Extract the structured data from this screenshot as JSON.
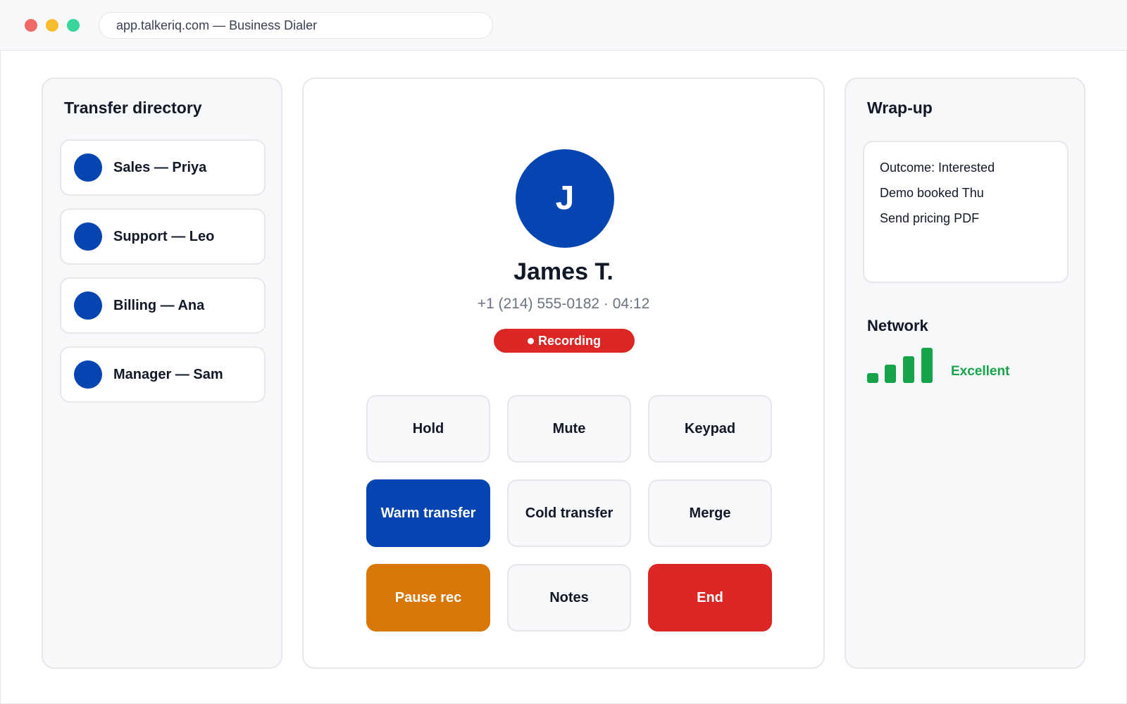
{
  "browser": {
    "url_text": "app.talkeriq.com — Business Dialer"
  },
  "directory": {
    "title": "Transfer directory",
    "items": [
      {
        "label": "Sales — Priya"
      },
      {
        "label": "Support — Leo"
      },
      {
        "label": "Billing — Ana"
      },
      {
        "label": "Manager — Sam"
      }
    ]
  },
  "caller": {
    "initial": "J",
    "name": "James T.",
    "meta": "+1 (214) 555-0182 · 04:12",
    "recording_label": "Recording"
  },
  "controls": {
    "hold": "Hold",
    "mute": "Mute",
    "keypad": "Keypad",
    "warm_transfer": "Warm transfer",
    "cold_transfer": "Cold transfer",
    "merge": "Merge",
    "pause_rec": "Pause rec",
    "notes": "Notes",
    "end": "End"
  },
  "wrapup": {
    "title": "Wrap-up",
    "notes": [
      "Outcome: Interested",
      "Demo booked Thu",
      "Send pricing PDF"
    ]
  },
  "network": {
    "title": "Network",
    "status": "Excellent",
    "signal_bars": 4,
    "signal_bars_max": 4
  },
  "colors": {
    "primary": "#0545b2",
    "danger": "#dc2626",
    "warning": "#d97706",
    "success": "#16a34a"
  }
}
